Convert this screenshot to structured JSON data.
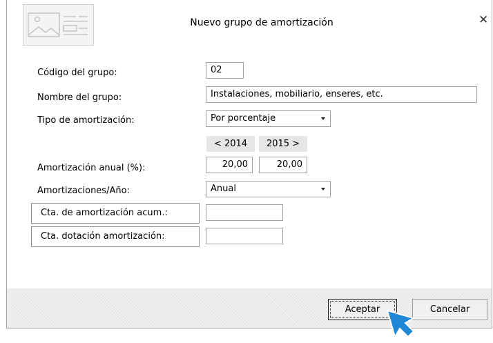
{
  "dialog": {
    "title": "Nuevo grupo de amortización"
  },
  "form": {
    "codigo_label": "Código del grupo:",
    "codigo_value": "02",
    "nombre_label": "Nombre del grupo:",
    "nombre_value": "Instalaciones, mobiliario, enseres, etc.",
    "tipo_label": "Tipo de amortización:",
    "tipo_value": "Por porcentaje",
    "year_prev": "< 2014",
    "year_next": "2015 >",
    "anual_label": "Amortización anual (%):",
    "anual_value_1": "20,00",
    "anual_value_2": "20,00",
    "amort_ano_label": "Amortizaciones/Año:",
    "amort_ano_value": "Anual",
    "cta_acum_label": "Cta. de amortización acum.:",
    "cta_acum_value": "",
    "cta_dot_label": "Cta. dotación amortización:",
    "cta_dot_value": ""
  },
  "buttons": {
    "accept": "Aceptar",
    "cancel": "Cancelar"
  },
  "icons": {
    "close": "close-icon",
    "header": "image-placeholder-icon",
    "cursor": "mouse-pointer-icon"
  },
  "colors": {
    "cursor": "#1e88d6"
  }
}
